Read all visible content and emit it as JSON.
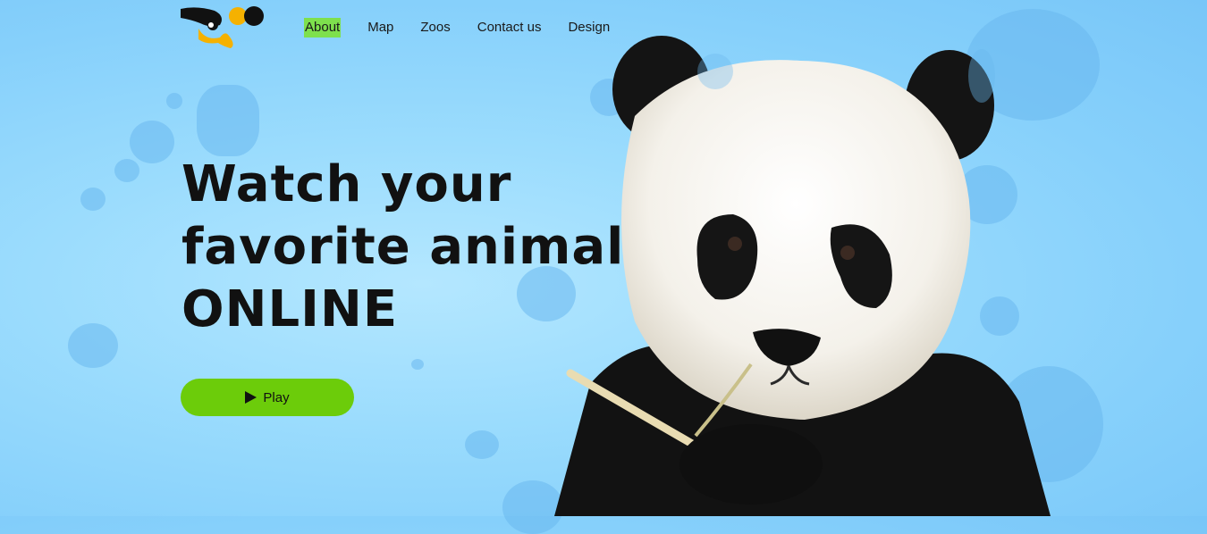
{
  "nav": {
    "items": [
      {
        "label": "About",
        "active": true
      },
      {
        "label": "Map",
        "active": false
      },
      {
        "label": "Zoos",
        "active": false
      },
      {
        "label": "Contact us",
        "active": false
      },
      {
        "label": "Design",
        "active": false
      }
    ]
  },
  "hero": {
    "title_line1": "Watch your",
    "title_line2": "favorite animal",
    "title_line3": "ONLINE",
    "play_label": "Play"
  },
  "colors": {
    "background": "#9bdcfd",
    "accent_green": "#6ccc0a",
    "nav_highlight": "#7ee04d",
    "logo_yellow": "#f5b100",
    "text": "#111111"
  },
  "icons": {
    "logo": "zoo-logo-icon",
    "play": "play-icon"
  }
}
